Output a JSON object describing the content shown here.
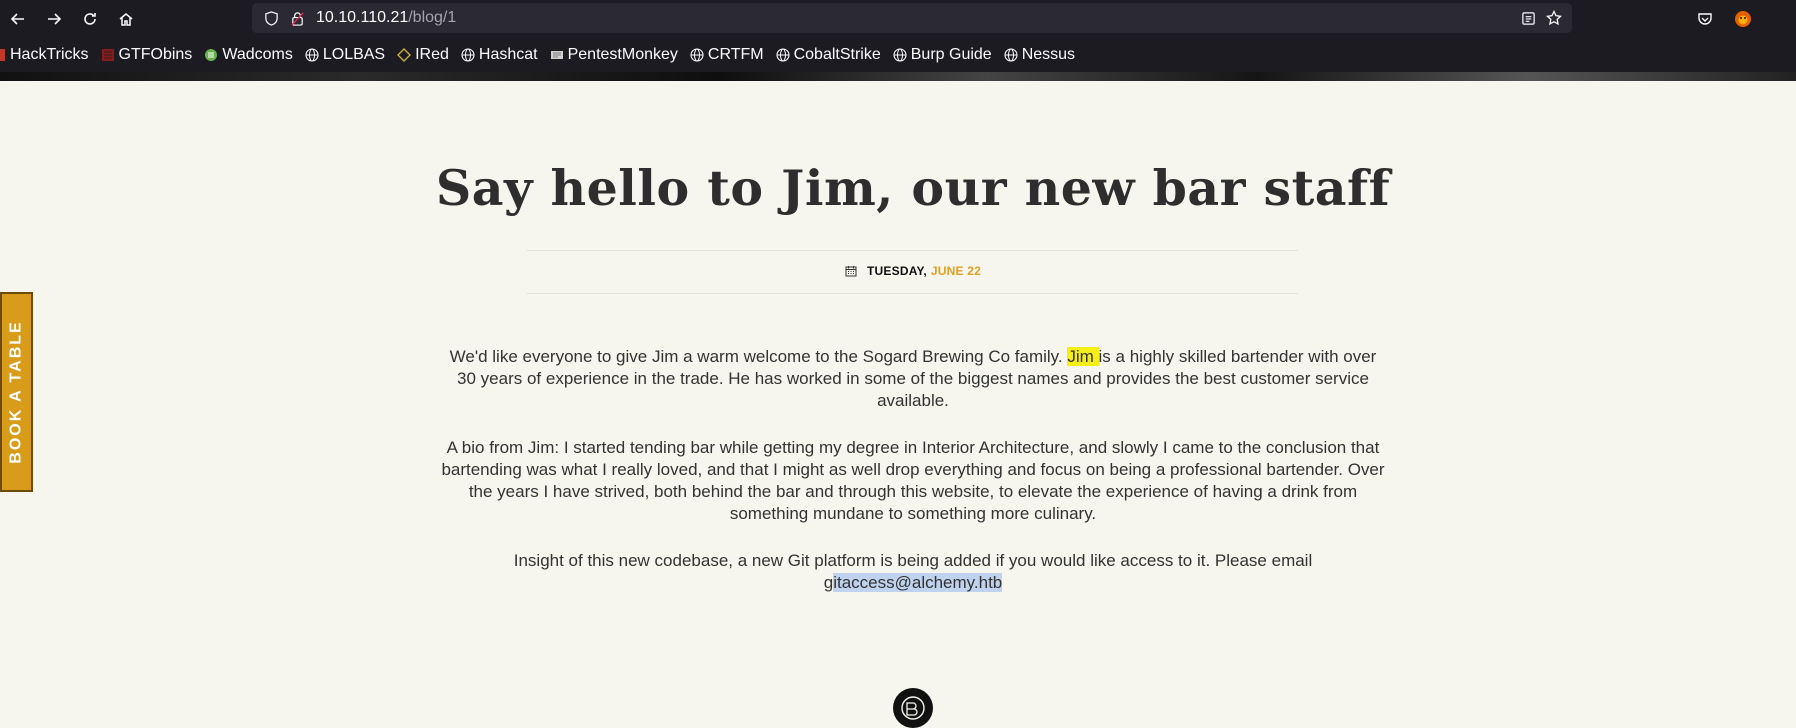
{
  "browser": {
    "url_host": "10.10.110.21",
    "url_path": "/blog/1",
    "bookmarks": [
      {
        "label": "HackTricks",
        "icon": "hacktricks-icon"
      },
      {
        "label": "GTFObins",
        "icon": "gtfobins-icon"
      },
      {
        "label": "Wadcoms",
        "icon": "wadcoms-icon"
      },
      {
        "label": "LOLBAS",
        "icon": "globe-icon"
      },
      {
        "label": "IRed",
        "icon": "ired-icon"
      },
      {
        "label": "Hashcat",
        "icon": "globe-icon"
      },
      {
        "label": "PentestMonkey",
        "icon": "pentestmonkey-icon"
      },
      {
        "label": "CRTFM",
        "icon": "globe-icon"
      },
      {
        "label": "CobaltStrike",
        "icon": "globe-icon"
      },
      {
        "label": "Burp Guide",
        "icon": "globe-icon"
      },
      {
        "label": "Nessus",
        "icon": "globe-icon"
      }
    ]
  },
  "post": {
    "title": "Say hello to Jim, our new bar staff",
    "day": "TUESDAY,",
    "month_day": "JUNE 22",
    "p1_a": "We'd like everyone to give Jim a warm welcome to the Sogard Brewing Co family. ",
    "p1_hl": "Jim ",
    "p1_b": "is a highly skilled bartender with over",
    "p1_line2": "30 years of experience in the trade. He has worked in some of the biggest names and provides the best customer service",
    "p1_line3": "available.",
    "p2_line1": "A bio from Jim: I started tending bar while getting my degree in Interior Architecture, and slowly I came to the conclusion that",
    "p2_line2": "bartending was what I really loved, and that I might as well drop everything and focus on being a professional bartender. Over",
    "p2_line3": "the years I have strived, both behind the bar and through this website, to elevate the experience of having a drink from",
    "p2_line4": "something mundane to something more culinary.",
    "p3_line1": "Insight of this new codebase, a new Git platform is being added if you would like access to it. Please email",
    "p3_email_a": "g",
    "p3_email_sel": "itaccess@alchemy.htb"
  },
  "sidebar": {
    "book_label": "BOOK A TABLE"
  },
  "colors": {
    "accent": "#e2a020",
    "book_bg": "#d89c1a",
    "page_bg": "#f6f5ee"
  }
}
